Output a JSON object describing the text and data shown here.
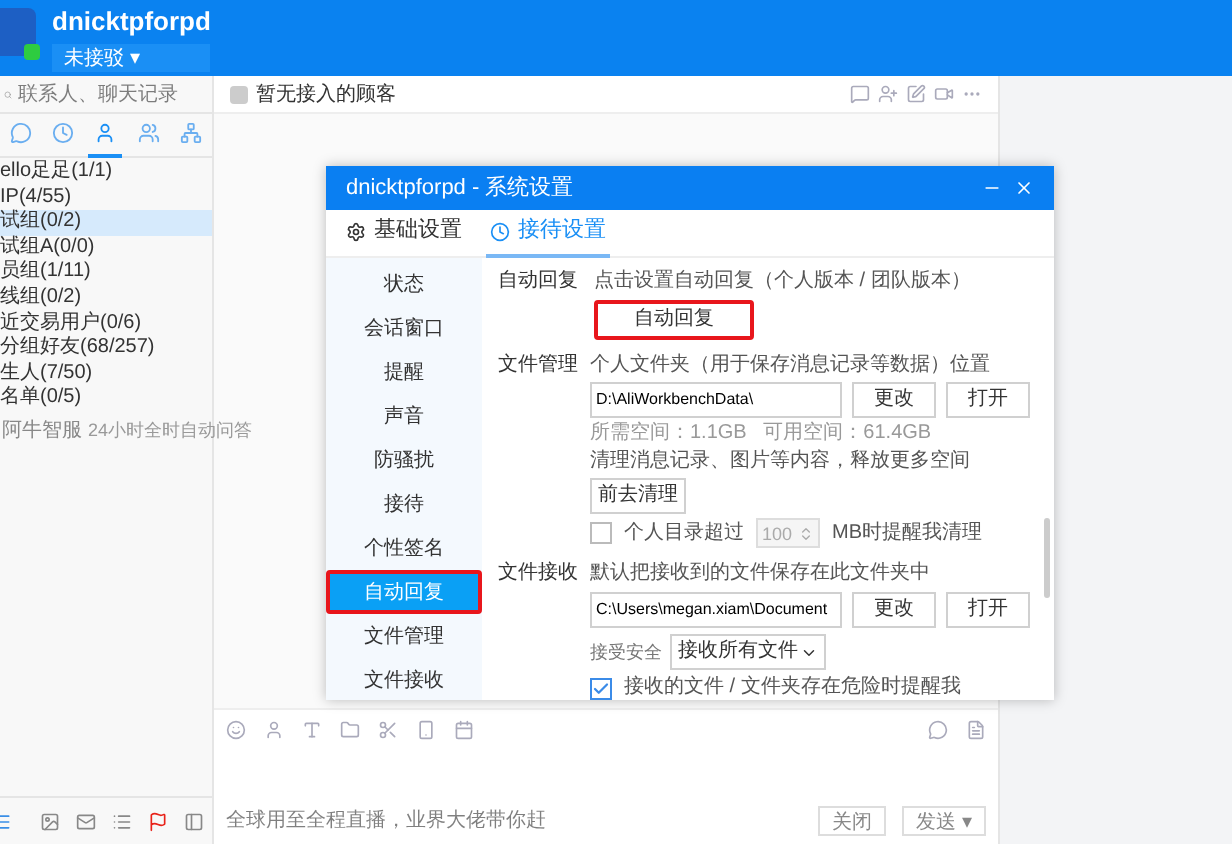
{
  "header": {
    "name": "dnicktpforpd",
    "status": "未接驳 ▾"
  },
  "sidebar": {
    "search_placeholder": "联系人、聊天记录",
    "tabs": [
      {
        "kind": "chat",
        "selected": false
      },
      {
        "kind": "clock",
        "selected": false
      },
      {
        "kind": "user",
        "selected": true
      },
      {
        "kind": "group",
        "selected": false
      },
      {
        "kind": "org",
        "selected": false
      }
    ],
    "groups": [
      {
        "label": "ello足足(1/1)",
        "selected": false
      },
      {
        "label": "IP(4/55)",
        "selected": false
      },
      {
        "label": "试组(0/2)",
        "selected": true
      },
      {
        "label": "试组A(0/0)",
        "selected": false
      },
      {
        "label": "员组(1/11)",
        "selected": false
      },
      {
        "label": "线组(0/2)",
        "selected": false
      },
      {
        "label": "近交易用户(0/6)",
        "selected": false
      },
      {
        "label": "分组好友(68/257)",
        "selected": false
      },
      {
        "label": "生人(7/50)",
        "selected": false
      },
      {
        "label": "名单(0/5)",
        "selected": false
      }
    ],
    "bot": {
      "name": "阿牛智服",
      "desc": "24小时全时自动问答"
    }
  },
  "chat": {
    "title": "暂无接入的顾客",
    "input_placeholder": "全球用至全程直播，业界大佬带你赶",
    "buttons": [
      "关闭",
      "发送 ▾"
    ]
  },
  "dialog": {
    "title": "dnicktpforpd - 系统设置",
    "tabs": [
      {
        "label": "基础设置",
        "selected": false
      },
      {
        "label": "接待设置",
        "selected": true
      }
    ],
    "nav": [
      {
        "label": "状态",
        "selected": false,
        "highlighted": false
      },
      {
        "label": "会话窗口",
        "selected": false,
        "highlighted": false
      },
      {
        "label": "提醒",
        "selected": false,
        "highlighted": false
      },
      {
        "label": "声音",
        "selected": false,
        "highlighted": false
      },
      {
        "label": "防骚扰",
        "selected": false,
        "highlighted": false
      },
      {
        "label": "接待",
        "selected": false,
        "highlighted": false
      },
      {
        "label": "个性签名",
        "selected": false,
        "highlighted": false
      },
      {
        "label": "自动回复",
        "selected": true,
        "highlighted": true
      },
      {
        "label": "文件管理",
        "selected": false,
        "highlighted": false
      },
      {
        "label": "文件接收",
        "selected": false,
        "highlighted": false
      }
    ],
    "auto_reply": {
      "label": "自动回复",
      "hint": "点击设置自动回复（个人版本 / 团队版本）",
      "button": "自动回复",
      "highlighted": true
    },
    "file_manage": {
      "label": "文件管理",
      "hint": "个人文件夹（用于保存消息记录等数据）位置",
      "path": "D:\\AliWorkbenchData\\",
      "buttons": [
        "更改",
        "打开"
      ],
      "space_info": "所需空间：1.1GB   可用空间：61.4GB",
      "cleanup_hint": "清理消息记录、图片等内容，释放更多空间",
      "cleanup_button": "前去清理",
      "limit": {
        "checked": false,
        "label": "个人目录超过",
        "value": "100",
        "unit": "MB时提醒我清理"
      }
    },
    "file_receive": {
      "label": "文件接收",
      "hint": "默认把接收到的文件保存在此文件夹中",
      "path": "C:\\Users\\megan.xiam\\Document",
      "buttons": [
        "更改",
        "打开"
      ],
      "security_label": "接受安全",
      "security_value": "接收所有文件",
      "warn": {
        "checked": true,
        "label": "接收的文件 / 文件夹存在危险时提醒我"
      }
    }
  }
}
